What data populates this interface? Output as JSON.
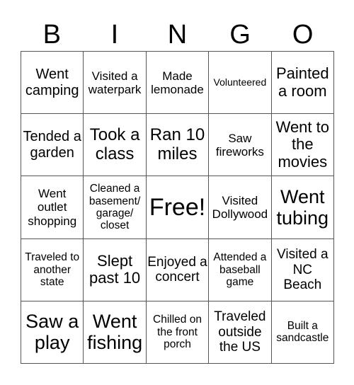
{
  "header": [
    "B",
    "I",
    "N",
    "G",
    "O"
  ],
  "cells": [
    [
      "Went camping",
      "Visited a waterpark",
      "Made lemonade",
      "Volunteered",
      "Painted a room"
    ],
    [
      "Tended a garden",
      "Took a class",
      "Ran 10 miles",
      "Saw fireworks",
      "Went to the movies"
    ],
    [
      "Went outlet shopping",
      "Cleaned a basement/ garage/ closet",
      "Free!",
      "Visited Dollywood",
      "Went tubing"
    ],
    [
      "Traveled to another state",
      "Slept past 10",
      "Enjoyed a concert",
      "Attended a baseball game",
      "Visited a NC Beach"
    ],
    [
      "Saw a play",
      "Went fishing",
      "Chilled on the front porch",
      "Traveled outside the US",
      "Built a sandcastle"
    ]
  ]
}
